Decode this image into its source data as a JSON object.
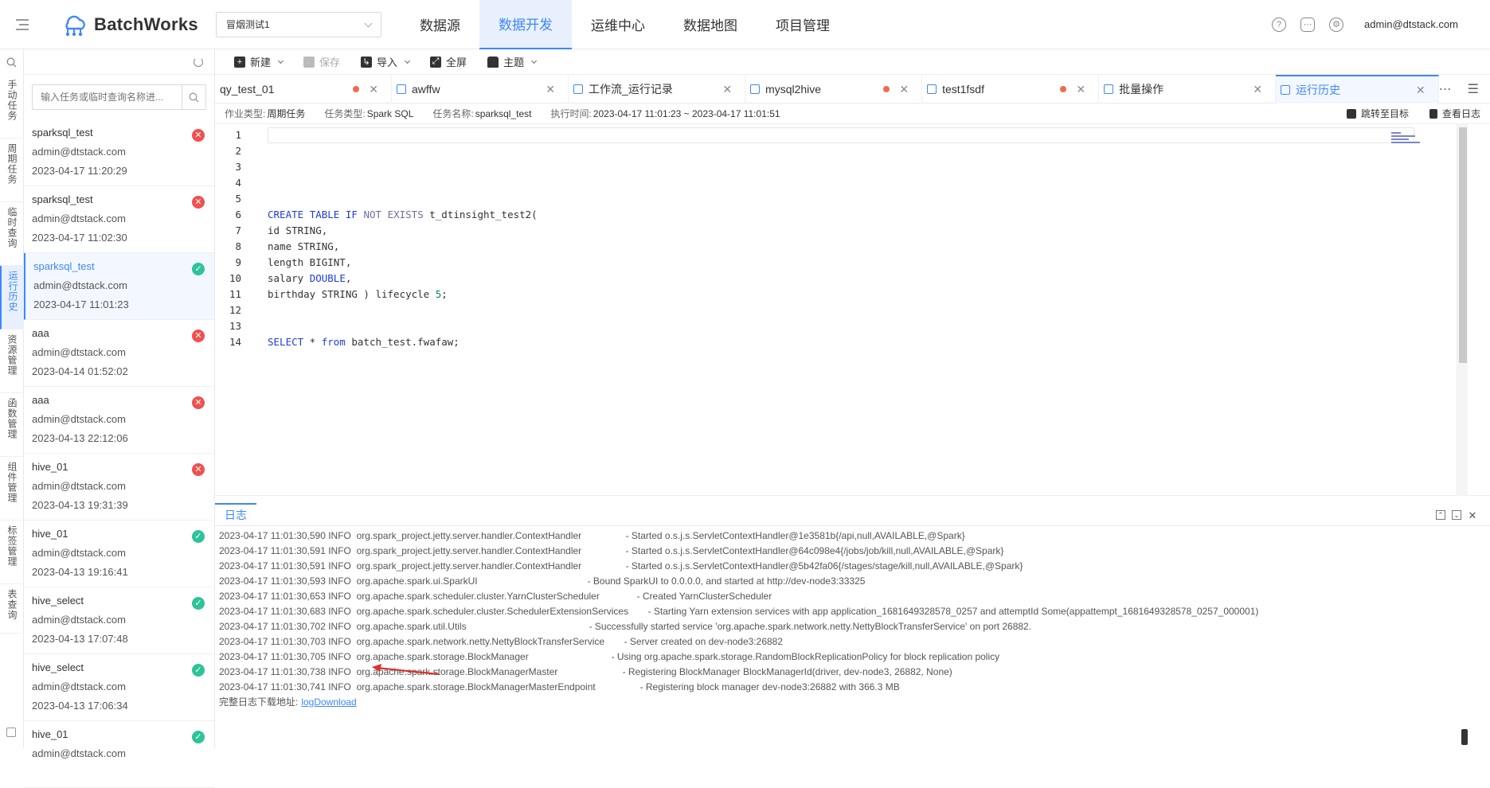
{
  "app": {
    "name": "BatchWorks"
  },
  "project_select": {
    "value": "冒烟测试1"
  },
  "nav": [
    {
      "label": "数据源"
    },
    {
      "label": "数据开发"
    },
    {
      "label": "运维中心"
    },
    {
      "label": "数据地图"
    },
    {
      "label": "项目管理"
    }
  ],
  "header": {
    "user": "admin@dtstack.com"
  },
  "side_tabs": [
    {
      "label": "手动任务"
    },
    {
      "label": "周期任务"
    },
    {
      "label": "临时查询"
    },
    {
      "label": "运行历史"
    },
    {
      "label": "资源管理"
    },
    {
      "label": "函数管理"
    },
    {
      "label": "组件管理"
    },
    {
      "label": "标签管理"
    },
    {
      "label": "表查询"
    }
  ],
  "task_search": {
    "placeholder": "输入任务或临时查询名称进..."
  },
  "tasks": [
    {
      "name": "sparksql_test",
      "user": "admin@dtstack.com",
      "time": "2023-04-17 11:20:29",
      "status": "fail"
    },
    {
      "name": "sparksql_test",
      "user": "admin@dtstack.com",
      "time": "2023-04-17 11:02:30",
      "status": "fail"
    },
    {
      "name": "sparksql_test",
      "user": "admin@dtstack.com",
      "time": "2023-04-17 11:01:23",
      "status": "success"
    },
    {
      "name": "aaa",
      "user": "admin@dtstack.com",
      "time": "2023-04-14 01:52:02",
      "status": "fail"
    },
    {
      "name": "aaa",
      "user": "admin@dtstack.com",
      "time": "2023-04-13 22:12:06",
      "status": "fail"
    },
    {
      "name": "hive_01",
      "user": "admin@dtstack.com",
      "time": "2023-04-13 19:31:39",
      "status": "fail"
    },
    {
      "name": "hive_01",
      "user": "admin@dtstack.com",
      "time": "2023-04-13 19:16:41",
      "status": "success"
    },
    {
      "name": "hive_select",
      "user": "admin@dtstack.com",
      "time": "2023-04-13 17:07:48",
      "status": "success"
    },
    {
      "name": "hive_select",
      "user": "admin@dtstack.com",
      "time": "2023-04-13 17:06:34",
      "status": "success"
    },
    {
      "name": "hive_01",
      "user": "admin@dtstack.com",
      "time": "",
      "status": "success"
    }
  ],
  "toolbar": {
    "new": "新建",
    "save": "保存",
    "import": "导入",
    "fullscreen": "全屏",
    "theme": "主题"
  },
  "tabs": [
    {
      "label": "qy_test_01",
      "dot": true
    },
    {
      "label": "awffw",
      "dot": false
    },
    {
      "label": "工作流_运行记录",
      "dot": false
    },
    {
      "label": "mysql2hive",
      "dot": true
    },
    {
      "label": "test1fsdf",
      "dot": true
    },
    {
      "label": "批量操作",
      "dot": false
    },
    {
      "label": "运行历史",
      "dot": false
    }
  ],
  "info": {
    "job_type_label": "作业类型:",
    "job_type": "周期任务",
    "task_type_label": "任务类型:",
    "task_type": "Spark SQL",
    "task_name_label": "任务名称:",
    "task_name": "sparksql_test",
    "exec_time_label": "执行时间:",
    "exec_time": "2023-04-17 11:01:23 ~ 2023-04-17 11:01:51",
    "jump_label": "跳转至目标",
    "view_log_label": "查看日志"
  },
  "code_lines": [
    "",
    "",
    "",
    "",
    "",
    "CREATE TABLE IF NOT EXISTS t_dtinsight_test2(",
    "id STRING,",
    "name STRING,",
    "length BIGINT,",
    "salary DOUBLE,",
    "birthday STRING ) lifecycle 5;",
    "",
    "",
    "SELECT * from batch_test.fwafaw;"
  ],
  "log": {
    "tab_label": "日志",
    "lines": [
      {
        "ts": "2023-04-17 11:01:30,590 INFO",
        "cls": "org.spark_project.jetty.server.handler.ContextHandler",
        "msg": "- Started o.s.j.s.ServletContextHandler@1e3581b{/api,null,AVAILABLE,@Spark}"
      },
      {
        "ts": "2023-04-17 11:01:30,591 INFO",
        "cls": "org.spark_project.jetty.server.handler.ContextHandler",
        "msg": "- Started o.s.j.s.ServletContextHandler@64c098e4{/jobs/job/kill,null,AVAILABLE,@Spark}"
      },
      {
        "ts": "2023-04-17 11:01:30,591 INFO",
        "cls": "org.spark_project.jetty.server.handler.ContextHandler",
        "msg": "- Started o.s.j.s.ServletContextHandler@5b42fa06{/stages/stage/kill,null,AVAILABLE,@Spark}"
      },
      {
        "ts": "2023-04-17 11:01:30,593 INFO",
        "cls": "org.apache.spark.ui.SparkUI",
        "msg": "- Bound SparkUI to 0.0.0.0, and started at http://dev-node3:33325"
      },
      {
        "ts": "2023-04-17 11:01:30,653 INFO",
        "cls": "org.apache.spark.scheduler.cluster.YarnClusterScheduler",
        "msg": "- Created YarnClusterScheduler"
      },
      {
        "ts": "2023-04-17 11:01:30,683 INFO",
        "cls": "org.apache.spark.scheduler.cluster.SchedulerExtensionServices",
        "msg": "- Starting Yarn extension services with app application_1681649328578_0257 and attemptId Some(appattempt_1681649328578_0257_000001)"
      },
      {
        "ts": "2023-04-17 11:01:30,702 INFO",
        "cls": "org.apache.spark.util.Utils",
        "msg": "- Successfully started service 'org.apache.spark.network.netty.NettyBlockTransferService' on port 26882."
      },
      {
        "ts": "2023-04-17 11:01:30,703 INFO",
        "cls": "org.apache.spark.network.netty.NettyBlockTransferService",
        "msg": "- Server created on dev-node3:26882"
      },
      {
        "ts": "2023-04-17 11:01:30,705 INFO",
        "cls": "org.apache.spark.storage.BlockManager",
        "msg": "- Using org.apache.spark.storage.RandomBlockReplicationPolicy for block replication policy"
      },
      {
        "ts": "2023-04-17 11:01:30,738 INFO",
        "cls": "org.apache.spark.storage.BlockManagerMaster",
        "msg": "- Registering BlockManager BlockManagerId(driver, dev-node3, 26882, None)"
      },
      {
        "ts": "2023-04-17 11:01:30,741 INFO",
        "cls": "org.apache.spark.storage.BlockManagerMasterEndpoint",
        "msg": "- Registering block manager dev-node3:26882 with 366.3 MB"
      }
    ],
    "download_label": "完整日志下载地址:",
    "download_link": "logDownload"
  },
  "colors": {
    "accent": "#3f87ff",
    "fail": "#f0504f",
    "success": "#2ec39a",
    "dirty_dot": "#ef6b4b",
    "annotation_arrow": "#d9332e"
  }
}
